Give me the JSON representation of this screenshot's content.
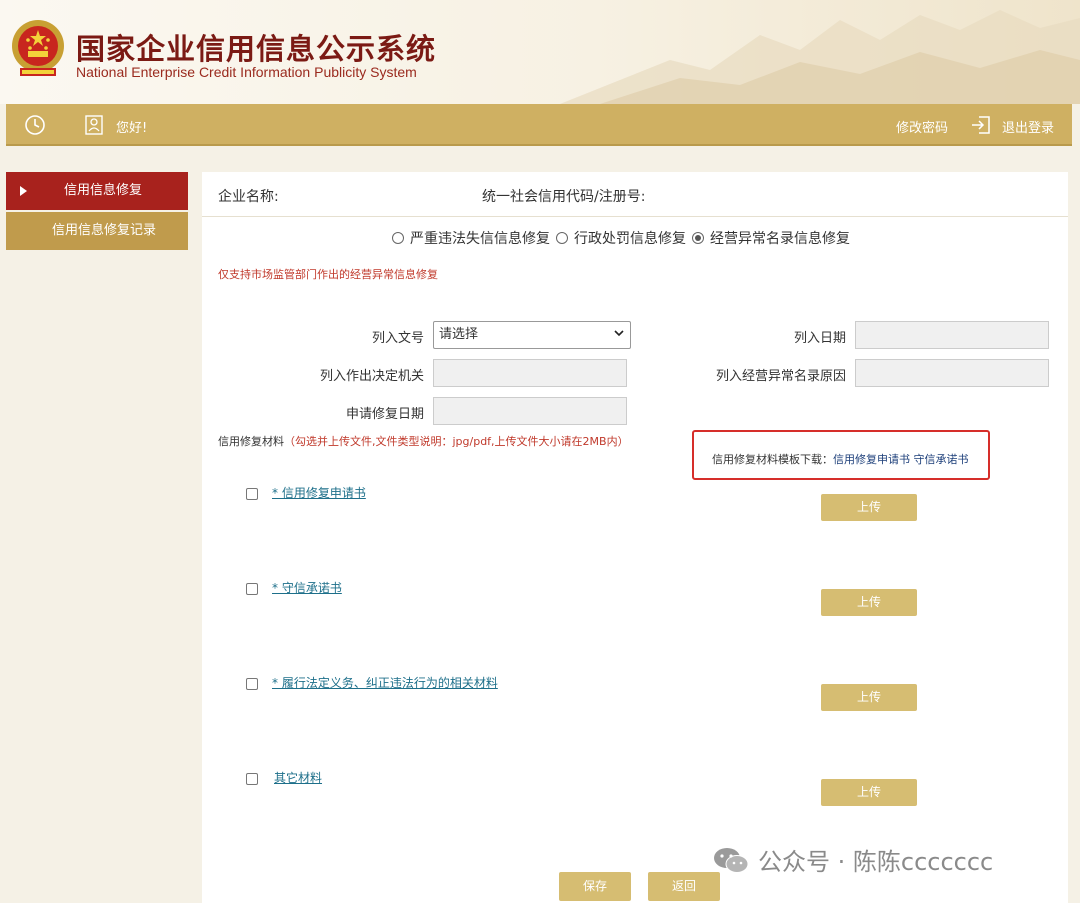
{
  "header": {
    "title": "国家企业信用信息公示系统",
    "subtitle": "National Enterprise Credit Information Publicity System"
  },
  "topbar": {
    "greeting": "您好!",
    "change_password": "修改密码",
    "logout": "退出登录"
  },
  "sidebar": {
    "items": [
      {
        "label": "信用信息修复",
        "active": true
      },
      {
        "label": "信用信息修复记录",
        "active": false
      }
    ]
  },
  "form": {
    "company_label": "企业名称:",
    "credit_code_label": "统一社会信用代码/注册号:",
    "repair_types": [
      {
        "label": "严重违法失信信息修复",
        "checked": false
      },
      {
        "label": "行政处罚信息修复",
        "checked": false
      },
      {
        "label": "经营异常名录信息修复",
        "checked": true
      }
    ],
    "notice": "仅支持市场监管部门作出的经营异常信息修复",
    "fields": {
      "doc_no_label": "列入文号",
      "doc_no_value": "请选择",
      "list_date_label": "列入日期",
      "authority_label": "列入作出决定机关",
      "reason_label": "列入经营异常名录原因",
      "apply_date_label": "申请修复日期"
    },
    "materials_label": "信用修复材料",
    "materials_hint": "（勾选并上传文件,文件类型说明：jpg/pdf,上传文件大小请在2MB内）",
    "template": {
      "prefix": "信用修复材料模板下载：",
      "link1": "信用修复申请书",
      "link2": "守信承诺书"
    },
    "materials": [
      {
        "label": "* 信用修复申请书",
        "upload": "上传"
      },
      {
        "label": "* 守信承诺书",
        "upload": "上传"
      },
      {
        "label": "* 履行法定义务、纠正违法行为的相关材料",
        "upload": "上传"
      },
      {
        "label": "其它材料",
        "upload": "上传"
      }
    ],
    "save": "保存",
    "back": "返回"
  },
  "watermark": "公众号 · 陈陈ccccccc",
  "colors": {
    "brand_red": "#a8221d",
    "gold": "#cfb062",
    "button_gold": "#d6bd72",
    "highlight_border": "#d62e2a"
  }
}
